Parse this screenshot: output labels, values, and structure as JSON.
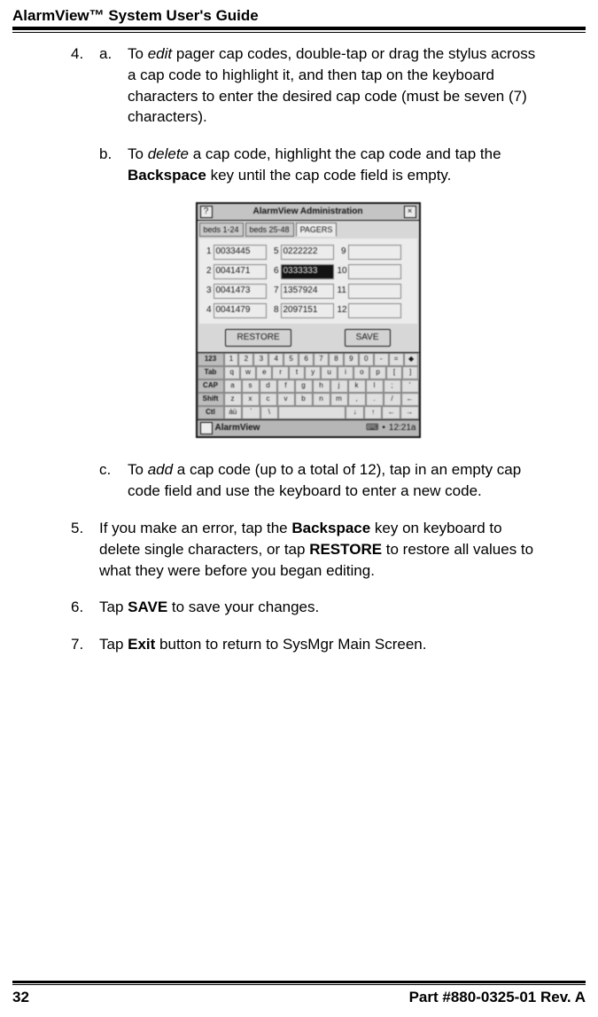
{
  "header": {
    "title": "AlarmView™ System User's Guide"
  },
  "items": {
    "four": {
      "num": "4.",
      "a": {
        "marker": "a.",
        "pre": "To ",
        "italic": "edit",
        "post": " pager cap codes, double-tap or drag the stylus across a cap code to highlight it, and then tap on the keyboard characters to enter the desired cap code (must be seven (7) characters)."
      },
      "b": {
        "marker": "b.",
        "pre": "To ",
        "italic": "delete",
        "mid": " a cap code, highlight the cap code and tap the ",
        "bold": "Backspace",
        "post": " key until the cap code field is empty."
      },
      "c": {
        "marker": "c.",
        "pre": "To ",
        "italic": "add",
        "post": " a cap code (up to a total of 12), tap in an empty cap code field and use the keyboard to enter a new code."
      }
    },
    "five": {
      "num": "5.",
      "pre": "If you make an error, tap the ",
      "bold1": "Backspace",
      "mid": " key on keyboard to delete single characters, or tap ",
      "bold2": "RESTORE",
      "post": " to restore all values to what they were before you began editing."
    },
    "six": {
      "num": "6.",
      "pre": "Tap ",
      "bold": "SAVE",
      "post": " to save your changes."
    },
    "seven": {
      "num": "7.",
      "pre": "Tap ",
      "bold": "Exit",
      "post": " button to return to SysMgr Main Screen."
    }
  },
  "device": {
    "help": "?",
    "title": "AlarmView Administration",
    "close": "×",
    "tabs": {
      "t1": "beds 1-24",
      "t2": "beds 25-48",
      "t3": "PAGERS"
    },
    "rows": {
      "r1": {
        "n1": "1",
        "v1": "0033445",
        "n2": "5",
        "v2": "0222222",
        "n3": "9",
        "v3": ""
      },
      "r2": {
        "n1": "2",
        "v1": "0041471",
        "n2": "6",
        "v2": "0333333",
        "n3": "10",
        "v3": ""
      },
      "r3": {
        "n1": "3",
        "v1": "0041473",
        "n2": "7",
        "v2": "1357924",
        "n3": "11",
        "v3": ""
      },
      "r4": {
        "n1": "4",
        "v1": "0041479",
        "n2": "8",
        "v2": "2097151",
        "n3": "12",
        "v3": ""
      }
    },
    "buttons": {
      "restore": "RESTORE",
      "save": "SAVE"
    },
    "kbd": {
      "row1_label": "123",
      "row1": [
        "1",
        "2",
        "3",
        "4",
        "5",
        "6",
        "7",
        "8",
        "9",
        "0",
        "-",
        "=",
        "◆"
      ],
      "row2_label": "Tab",
      "row2": [
        "q",
        "w",
        "e",
        "r",
        "t",
        "y",
        "u",
        "i",
        "o",
        "p",
        "[",
        "]"
      ],
      "row3_label": "CAP",
      "row3": [
        "a",
        "s",
        "d",
        "f",
        "g",
        "h",
        "j",
        "k",
        "l",
        ";",
        "'"
      ],
      "row4_label": "Shift",
      "row4": [
        "z",
        "x",
        "c",
        "v",
        "b",
        "n",
        "m",
        ",",
        ".",
        "/",
        "←"
      ],
      "row5_label": "Ctl",
      "row5": [
        "áü",
        "`",
        "\\",
        "",
        "",
        "",
        "",
        "",
        "↓",
        "↑",
        "←",
        "→"
      ]
    },
    "taskbar": {
      "app": "AlarmView",
      "time": "12:21a",
      "kbd_icon": "⌨",
      "sep": "•"
    }
  },
  "footer": {
    "page": "32",
    "part": "Part #880-0325-01 Rev. A"
  }
}
